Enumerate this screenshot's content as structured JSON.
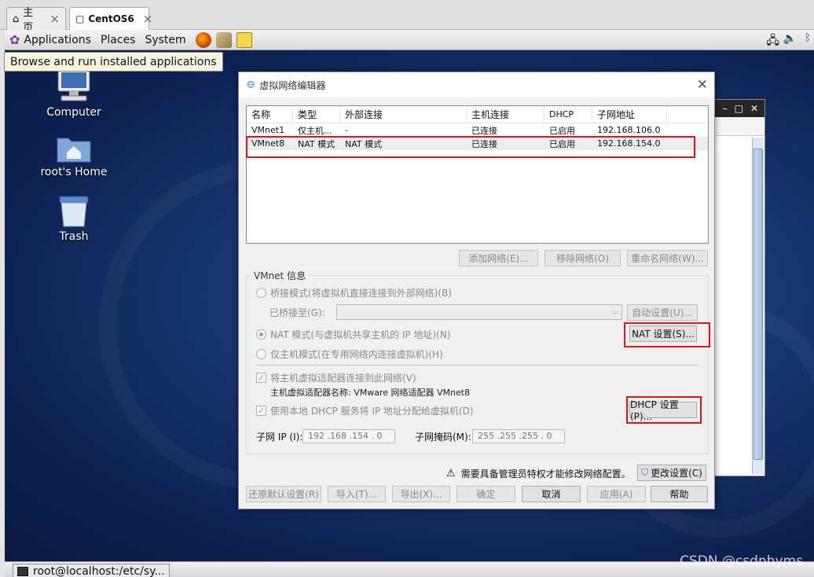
{
  "browser_tabs": [
    {
      "label": "主页",
      "icon": "home-icon"
    },
    {
      "label": "CentOS6",
      "icon": "vm-icon"
    }
  ],
  "panel": {
    "applications": "Applications",
    "places": "Places",
    "system": "System"
  },
  "tooltip": "Browse and run installed applications",
  "desktop_icons": [
    {
      "label": "Computer",
      "icon": "computer-icon"
    },
    {
      "label": "root's Home",
      "icon": "home-folder-icon"
    },
    {
      "label": "Trash",
      "icon": "trash-icon"
    }
  ],
  "dialog": {
    "title": "虚拟网络编辑器",
    "columns": [
      "名称",
      "类型",
      "外部连接",
      "主机连接",
      "DHCP",
      "子网地址"
    ],
    "rows": [
      [
        "VMnet1",
        "仅主机...",
        "-",
        "已连接",
        "已启用",
        "192.168.106.0"
      ],
      [
        "VMnet8",
        "NAT 模式",
        "NAT 模式",
        "已连接",
        "已启用",
        "192.168.154.0"
      ]
    ],
    "add_network": "添加网络(E)...",
    "remove_network": "移除网络(O)",
    "rename_network": "重命名网络(W)...",
    "group_title": "VMnet 信息",
    "bridge_mode": "桥接模式(将虚拟机直接连接到外部网络)(B)",
    "bridged_to_label": "已桥接至(G):",
    "auto_settings": "自动设置(U)...",
    "nat_mode": "NAT 模式(与虚拟机共享主机的 IP 地址)(N)",
    "nat_settings": "NAT 设置(S)...",
    "host_only_mode": "仅主机模式(在专用网络内连接虚拟机)(H)",
    "connect_adapter": "将主机虚拟适配器连接到此网络(V)",
    "adapter_name": "主机虚拟适配器名称: VMware 网络适配器 VMnet8",
    "use_dhcp": "使用本地 DHCP 服务将 IP 地址分配给虚拟机(D)",
    "dhcp_settings": "DHCP 设置(P)...",
    "subnet_ip_label": "子网 IP (I):",
    "subnet_ip": "192 .168 .154 . 0",
    "subnet_mask_label": "子网掩码(M):",
    "subnet_mask": "255 .255 .255 . 0",
    "admin_notice": "需要具备管理员特权才能修改网络配置。",
    "change_settings": "更改设置(C)",
    "restore_defaults": "还原默认设置(R)",
    "import": "导入(T)...",
    "export": "导出(X)...",
    "ok": "确定",
    "cancel": "取消",
    "apply": "应用(A)",
    "help": "帮助"
  },
  "taskbar": {
    "item": "root@localhost:/etc/sy..."
  },
  "watermark": "CSDN @csdnhyms",
  "colors": {
    "highlight": "#e5141a",
    "desktop": "#183670"
  }
}
